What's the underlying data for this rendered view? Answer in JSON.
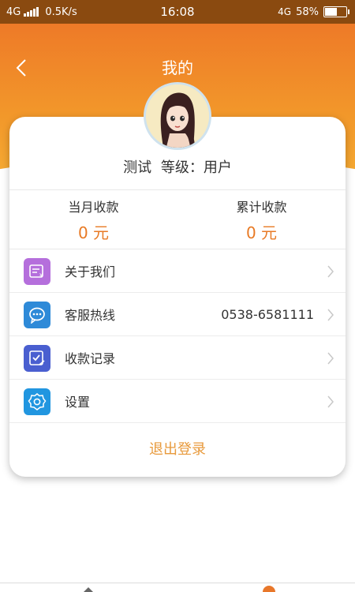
{
  "status_bar": {
    "network": "4G",
    "speed": "0.5K/s",
    "time": "16:08",
    "network_right": "4G",
    "battery": "58%",
    "battery_level": 0.58
  },
  "header": {
    "title": "我的"
  },
  "user": {
    "name": "测试",
    "level": "等级：用户"
  },
  "stats": {
    "month_label": "当月收款",
    "month_value": "0 元",
    "total_label": "累计收款",
    "total_value": "0 元"
  },
  "menu": [
    {
      "label": "关于我们",
      "value": "",
      "icon": "about-icon",
      "color": "#b56fdc"
    },
    {
      "label": "客服热线",
      "value": "0538-6581111",
      "icon": "chat-bubble-icon",
      "color": "#2e8ad8"
    },
    {
      "label": "收款记录",
      "value": "",
      "icon": "record-check-icon",
      "color": "#4a5fd0"
    },
    {
      "label": "设置",
      "value": "",
      "icon": "gear-icon",
      "color": "#2196e0"
    }
  ],
  "logout_label": "退出登录",
  "colors": {
    "accent": "#e87a25",
    "header_top": "#ee7a28",
    "header_bottom": "#f5a932",
    "status_bar": "#8a4a10"
  }
}
